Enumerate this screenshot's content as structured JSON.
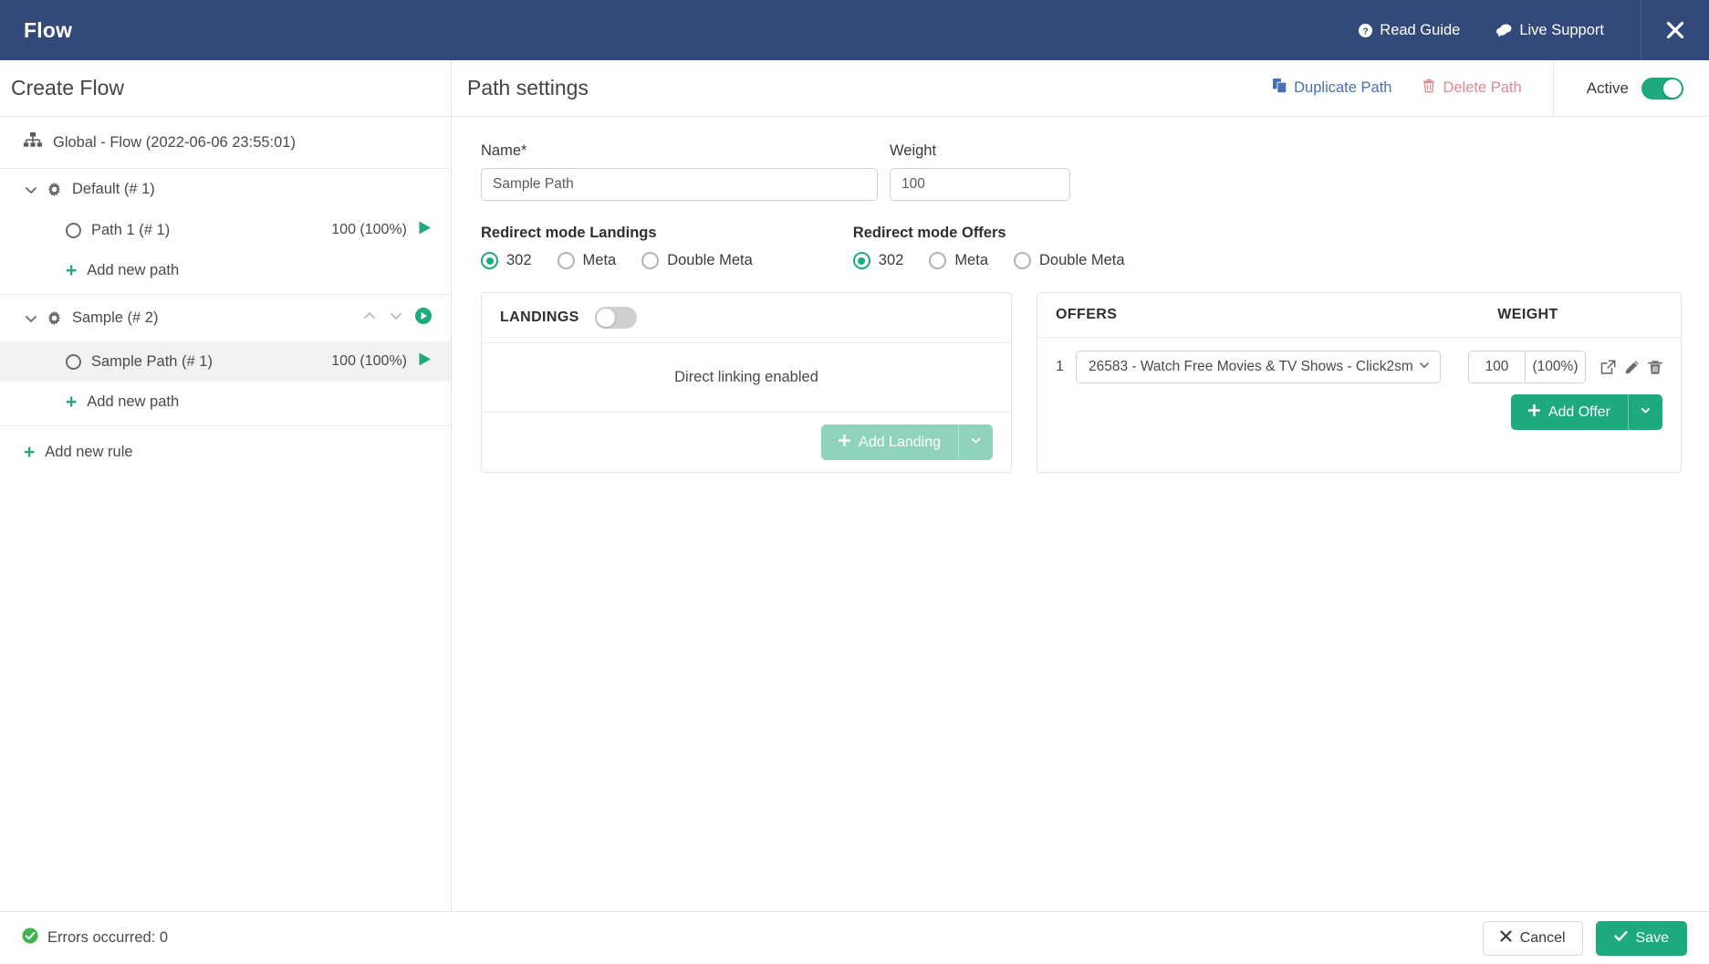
{
  "topbar": {
    "title": "Flow",
    "read_guide": "Read Guide",
    "live_support": "Live Support",
    "close_label": "×"
  },
  "sidebar": {
    "header": "Create Flow",
    "root": {
      "label": "Global - Flow (2022-06-06 23:55:01)",
      "icon": "sitemap-icon"
    },
    "rules": [
      {
        "label": "Default (# 1)",
        "paths": [
          {
            "label": "Path 1 (# 1)",
            "weight": "100 (100%)",
            "selected": false
          }
        ],
        "add_path": "Add new path",
        "show_reorder": false
      },
      {
        "label": "Sample (# 2)",
        "paths": [
          {
            "label": "Sample Path (# 1)",
            "weight": "100 (100%)",
            "selected": true
          }
        ],
        "add_path": "Add new path",
        "show_reorder": true
      }
    ],
    "add_rule": "Add new rule"
  },
  "main": {
    "title": "Path settings",
    "duplicate_path": "Duplicate Path",
    "delete_path": "Delete Path",
    "active_label": "Active",
    "active_on": true,
    "name_label": "Name*",
    "name_value": "Sample Path",
    "name_placeholder": "Name",
    "weight_label": "Weight",
    "weight_value": "100",
    "weight_placeholder": "Weight",
    "redirect_landings": {
      "label": "Redirect mode Landings",
      "options": [
        "302",
        "Meta",
        "Double Meta"
      ],
      "selected": "302"
    },
    "redirect_offers": {
      "label": "Redirect mode Offers",
      "options": [
        "302",
        "Meta",
        "Double Meta"
      ],
      "selected": "302"
    },
    "landings_panel": {
      "title": "LANDINGS",
      "toggle_on": false,
      "empty_text": "Direct linking enabled",
      "add_button": "Add Landing"
    },
    "offers_panel": {
      "title": "OFFERS",
      "weight_title": "WEIGHT",
      "rows": [
        {
          "index": "1",
          "offer": "26583 - Watch Free Movies & TV Shows - Click2sm",
          "weight": "100",
          "percent": "(100%)"
        }
      ],
      "add_button": "Add Offer"
    }
  },
  "footer": {
    "errors": "Errors occurred: 0",
    "cancel": "Cancel",
    "save": "Save"
  },
  "colors": {
    "header_blue": "#32497a",
    "accent_green": "#1fa97f",
    "muted_green": "#8fd3bd",
    "link_blue": "#4a6fb5",
    "danger_red": "#e08890"
  }
}
